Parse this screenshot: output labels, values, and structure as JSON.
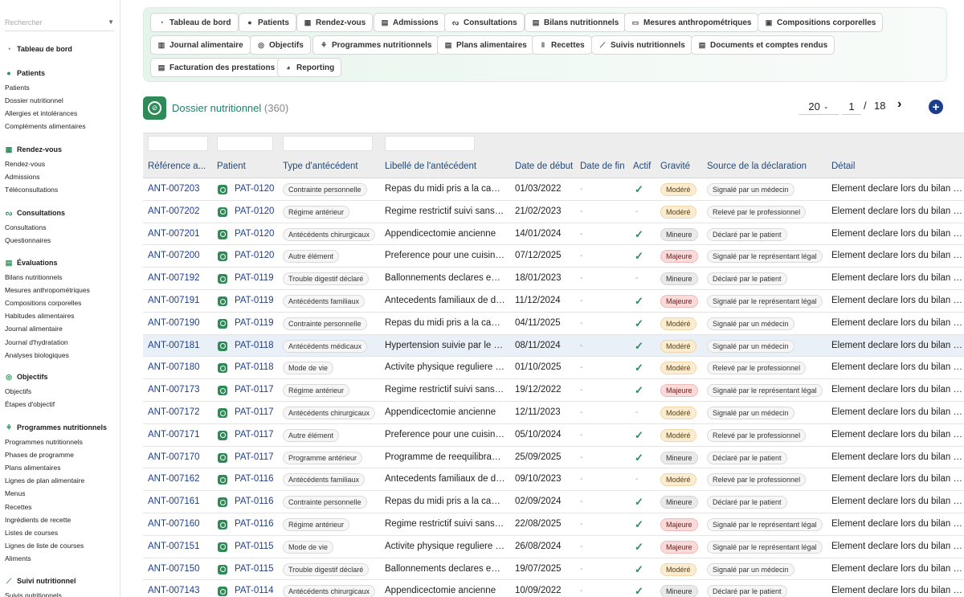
{
  "sidebar": {
    "search_placeholder": "Rechercher",
    "groups": [
      {
        "label": "Tableau de bord",
        "icon": "dashboard-icon",
        "items": []
      },
      {
        "label": "Patients",
        "icon": "user-icon",
        "items": [
          "Patients",
          "Dossier nutritionnel",
          "Allergies et intolérances",
          "Compléments alimentaires"
        ]
      },
      {
        "label": "Rendez-vous",
        "icon": "calendar-icon",
        "items": [
          "Rendez-vous",
          "Admissions",
          "Téléconsultations"
        ]
      },
      {
        "label": "Consultations",
        "icon": "stethoscope-icon",
        "items": [
          "Consultations",
          "Questionnaires"
        ]
      },
      {
        "label": "Évaluations",
        "icon": "clipboard-icon",
        "items": [
          "Bilans nutritionnels",
          "Mesures anthropométriques",
          "Compositions corporelles",
          "Habitudes alimentaires",
          "Journal alimentaire",
          "Journal d'hydratation",
          "Analyses biologiques"
        ]
      },
      {
        "label": "Objectifs",
        "icon": "target-icon",
        "items": [
          "Objectifs",
          "Étapes d'objectif"
        ]
      },
      {
        "label": "Programmes nutritionnels",
        "icon": "sprout-icon",
        "items": [
          "Programmes nutritionnels",
          "Phases de programme",
          "Plans alimentaires",
          "Lignes de plan alimentaire",
          "Menus",
          "Recettes",
          "Ingrédients de recette",
          "Listes de courses",
          "Lignes de liste de courses",
          "Aliments"
        ]
      },
      {
        "label": "Suivi nutritionnel",
        "icon": "chart-line-icon",
        "items": [
          "Suivis nutritionnels"
        ]
      }
    ]
  },
  "topnav": [
    {
      "label": "Tableau de bord",
      "icon": "dashboard-icon"
    },
    {
      "label": "Patients",
      "icon": "user-icon"
    },
    {
      "label": "Rendez-vous",
      "icon": "calendar-icon"
    },
    {
      "label": "Admissions",
      "icon": "clipboard-icon"
    },
    {
      "label": "Consultations",
      "icon": "stethoscope-icon"
    },
    {
      "label": "Bilans nutritionnels",
      "icon": "clipboard-icon"
    },
    {
      "label": "Mesures anthropométriques",
      "icon": "ruler-icon"
    },
    {
      "label": "Compositions corporelles",
      "icon": "scale-icon"
    },
    {
      "label": "Journal alimentaire",
      "icon": "book-icon"
    },
    {
      "label": "Objectifs",
      "icon": "target-icon"
    },
    {
      "label": "Programmes nutritionnels",
      "icon": "sprout-icon"
    },
    {
      "label": "Plans alimentaires",
      "icon": "clipboard-icon"
    },
    {
      "label": "Recettes",
      "icon": "utensils-icon"
    },
    {
      "label": "Suivis nutritionnels",
      "icon": "chart-line-icon"
    },
    {
      "label": "Documents et comptes rendus",
      "icon": "document-icon"
    },
    {
      "label": "Facturation des prestations",
      "icon": "invoice-icon"
    },
    {
      "label": "Reporting",
      "icon": "pie-chart-icon"
    }
  ],
  "page": {
    "title": "Dossier nutritionnel",
    "count": "(360)"
  },
  "pager": {
    "page_size": "20",
    "current_page": "1",
    "separator": "/",
    "total_pages": "18"
  },
  "colors": {
    "accent": "#2e8b57",
    "link": "#1d3f8f",
    "add_button": "#1a3e8c"
  },
  "table": {
    "columns": [
      "Référence a...",
      "Patient",
      "Type d'antécédent",
      "Libellé de l'antécédent",
      "Date de début",
      "Date de fin",
      "Actif",
      "Gravité",
      "Source de la déclaration",
      "Détail"
    ],
    "rows": [
      {
        "ref": "ANT-007203",
        "patient": "PAT-0120",
        "type": "Contrainte personnelle",
        "label": "Repas du midi pris a la cantine",
        "start": "01/03/2022",
        "end": "-",
        "active": true,
        "severity": "Modéré",
        "source": "Signalé par un médecin",
        "detail": "Element declare lors du bilan initial"
      },
      {
        "ref": "ANT-007202",
        "patient": "PAT-0120",
        "type": "Régime antérieur",
        "label": "Regime restrictif suivi sans encadrement",
        "start": "21/02/2023",
        "end": "-",
        "active": false,
        "severity": "Modéré",
        "source": "Relevé par le professionnel",
        "detail": "Element declare lors du bilan initial"
      },
      {
        "ref": "ANT-007201",
        "patient": "PAT-0120",
        "type": "Antécédents chirurgicaux",
        "label": "Appendicectomie ancienne",
        "start": "14/01/2024",
        "end": "-",
        "active": true,
        "severity": "Mineure",
        "source": "Déclaré par le patient",
        "detail": "Element declare lors du bilan initial"
      },
      {
        "ref": "ANT-007200",
        "patient": "PAT-0120",
        "type": "Autre élément",
        "label": "Preference pour une cuisine maison",
        "start": "07/12/2025",
        "end": "-",
        "active": true,
        "severity": "Majeure",
        "source": "Signalé par le représentant légal",
        "detail": "Element declare lors du bilan initial"
      },
      {
        "ref": "ANT-007192",
        "patient": "PAT-0119",
        "type": "Trouble digestif déclaré",
        "label": "Ballonnements declares en fin de journee",
        "start": "18/01/2023",
        "end": "-",
        "active": false,
        "severity": "Mineure",
        "source": "Déclaré par le patient",
        "detail": "Element declare lors du bilan initial"
      },
      {
        "ref": "ANT-007191",
        "patient": "PAT-0119",
        "type": "Antécédents familiaux",
        "label": "Antecedents familiaux de diabete",
        "start": "11/12/2024",
        "end": "-",
        "active": true,
        "severity": "Majeure",
        "source": "Signalé par le représentant légal",
        "detail": "Element declare lors du bilan initial"
      },
      {
        "ref": "ANT-007190",
        "patient": "PAT-0119",
        "type": "Contrainte personnelle",
        "label": "Repas du midi pris a la cantine",
        "start": "04/11/2025",
        "end": "-",
        "active": true,
        "severity": "Modéré",
        "source": "Signalé par un médecin",
        "detail": "Element declare lors du bilan initial"
      },
      {
        "ref": "ANT-007181",
        "patient": "PAT-0118",
        "type": "Antécédents médicaux",
        "label": "Hypertension suivie par le medecin traitant",
        "start": "08/11/2024",
        "end": "-",
        "active": true,
        "severity": "Modéré",
        "source": "Signalé par un médecin",
        "detail": "Element declare lors du bilan initial"
      },
      {
        "ref": "ANT-007180",
        "patient": "PAT-0118",
        "type": "Mode de vie",
        "label": "Activite physique reguliere limitee",
        "start": "01/10/2025",
        "end": "-",
        "active": true,
        "severity": "Modéré",
        "source": "Relevé par le professionnel",
        "detail": "Element declare lors du bilan initial"
      },
      {
        "ref": "ANT-007173",
        "patient": "PAT-0117",
        "type": "Régime antérieur",
        "label": "Regime restrictif suivi sans encadrement",
        "start": "19/12/2022",
        "end": "-",
        "active": true,
        "severity": "Majeure",
        "source": "Signalé par le représentant légal",
        "detail": "Element declare lors du bilan initial"
      },
      {
        "ref": "ANT-007172",
        "patient": "PAT-0117",
        "type": "Antécédents chirurgicaux",
        "label": "Appendicectomie ancienne",
        "start": "12/11/2023",
        "end": "-",
        "active": false,
        "severity": "Modéré",
        "source": "Signalé par un médecin",
        "detail": "Element declare lors du bilan initial"
      },
      {
        "ref": "ANT-007171",
        "patient": "PAT-0117",
        "type": "Autre élément",
        "label": "Preference pour une cuisine maison",
        "start": "05/10/2024",
        "end": "-",
        "active": true,
        "severity": "Modéré",
        "source": "Relevé par le professionnel",
        "detail": "Element declare lors du bilan initial"
      },
      {
        "ref": "ANT-007170",
        "patient": "PAT-0117",
        "type": "Programme antérieur",
        "label": "Programme de reequilibrage alimentaire",
        "start": "25/09/2025",
        "end": "-",
        "active": true,
        "severity": "Mineure",
        "source": "Déclaré par le patient",
        "detail": "Element declare lors du bilan initial"
      },
      {
        "ref": "ANT-007162",
        "patient": "PAT-0116",
        "type": "Antécédents familiaux",
        "label": "Antecedents familiaux de diabete",
        "start": "09/10/2023",
        "end": "-",
        "active": false,
        "severity": "Modéré",
        "source": "Relevé par le professionnel",
        "detail": "Element declare lors du bilan initial"
      },
      {
        "ref": "ANT-007161",
        "patient": "PAT-0116",
        "type": "Contrainte personnelle",
        "label": "Repas du midi pris a la cantine",
        "start": "02/09/2024",
        "end": "-",
        "active": true,
        "severity": "Mineure",
        "source": "Déclaré par le patient",
        "detail": "Element declare lors du bilan initial"
      },
      {
        "ref": "ANT-007160",
        "patient": "PAT-0116",
        "type": "Régime antérieur",
        "label": "Regime restrictif suivi sans encadrement",
        "start": "22/08/2025",
        "end": "-",
        "active": true,
        "severity": "Majeure",
        "source": "Signalé par le représentant légal",
        "detail": "Element declare lors du bilan initial"
      },
      {
        "ref": "ANT-007151",
        "patient": "PAT-0115",
        "type": "Mode de vie",
        "label": "Activite physique reguliere limitee",
        "start": "26/08/2024",
        "end": "-",
        "active": true,
        "severity": "Majeure",
        "source": "Signalé par le représentant légal",
        "detail": "Element declare lors du bilan initial"
      },
      {
        "ref": "ANT-007150",
        "patient": "PAT-0115",
        "type": "Trouble digestif déclaré",
        "label": "Ballonnements declares en fin de journee",
        "start": "19/07/2025",
        "end": "-",
        "active": true,
        "severity": "Modéré",
        "source": "Signalé par un médecin",
        "detail": "Element declare lors du bilan initial"
      },
      {
        "ref": "ANT-007143",
        "patient": "PAT-0114",
        "type": "Antécédents chirurgicaux",
        "label": "Appendicectomie ancienne",
        "start": "10/09/2022",
        "end": "-",
        "active": true,
        "severity": "Mineure",
        "source": "Déclaré par le patient",
        "detail": "Element declare lors du bilan initial"
      }
    ]
  }
}
